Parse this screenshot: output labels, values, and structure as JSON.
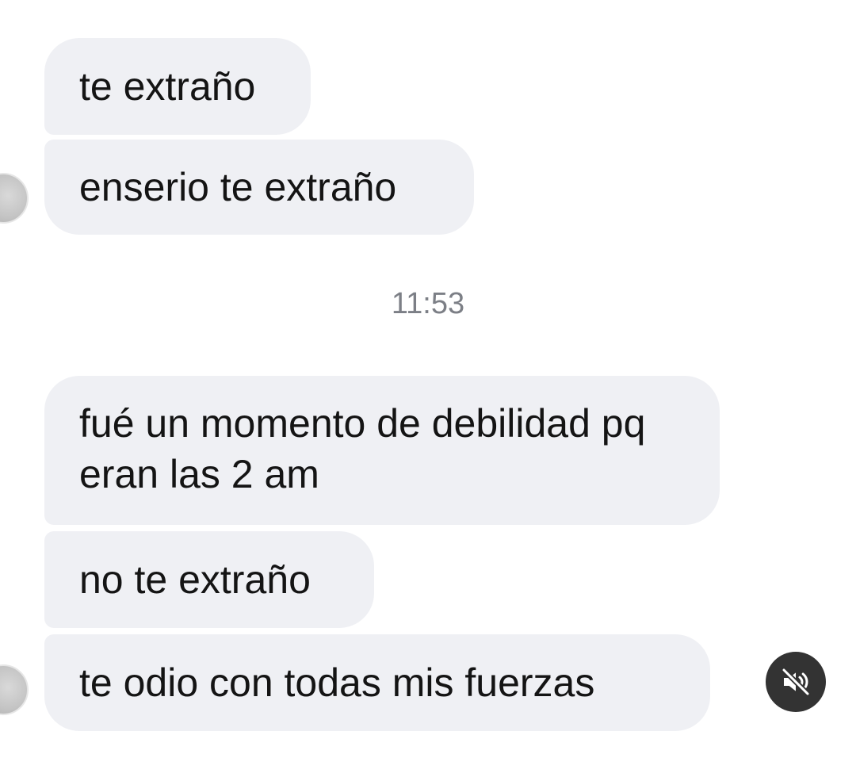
{
  "messages": [
    {
      "text": "te extraño"
    },
    {
      "text": "enserio te extraño"
    },
    {
      "text": "fué un momento de debilidad pq eran las 2 am"
    },
    {
      "text": "no te extraño"
    },
    {
      "text": "te odio con todas mis fuerzas"
    }
  ],
  "timestamp": "11:53",
  "icons": {
    "avatar": "avatar",
    "mute": "speaker-muted-icon"
  },
  "colors": {
    "bubble": "#eff0f4",
    "text": "#141414",
    "timestamp": "#7c7f86",
    "mute_button": "#333333"
  }
}
